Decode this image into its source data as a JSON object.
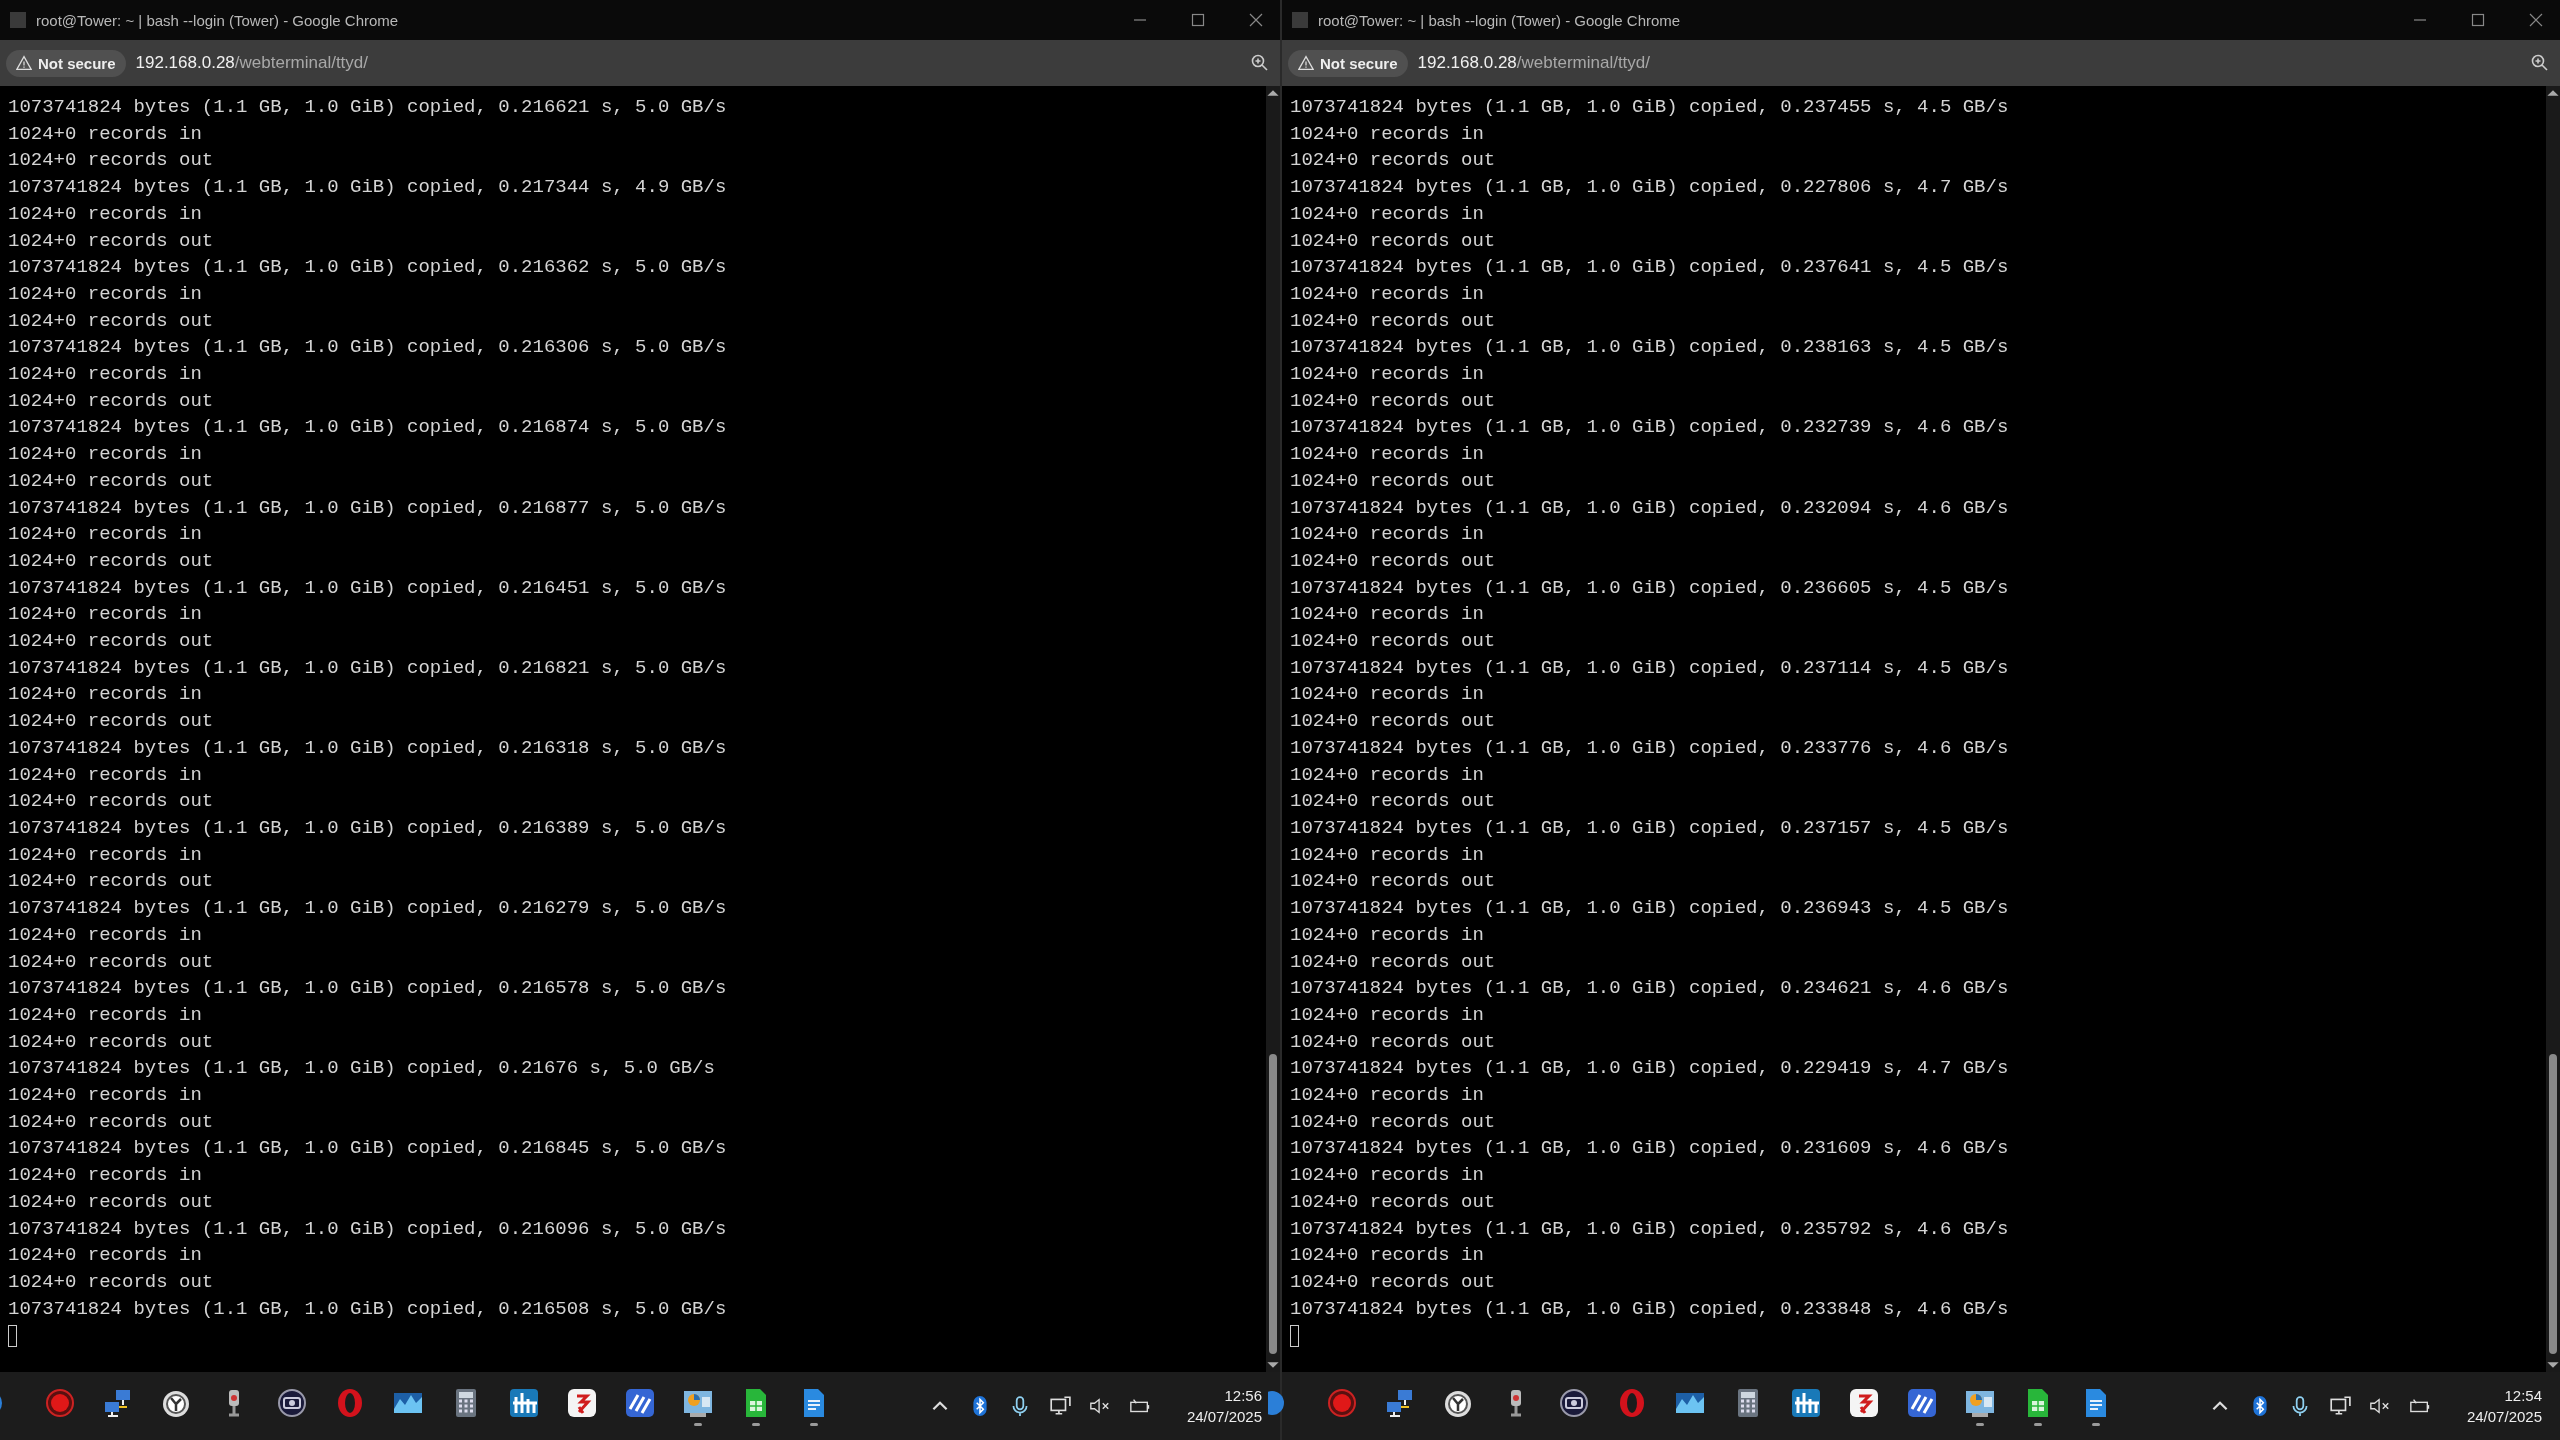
{
  "windows": [
    {
      "title": "root@Tower: ~ | bash --login (Tower) - Google Chrome",
      "security_label": "Not secure",
      "url_host": "192.168.0.28",
      "url_path": "/webterminal/ttyd/",
      "lines": [
        "1073741824 bytes (1.1 GB, 1.0 GiB) copied, 0.216621 s, 5.0 GB/s",
        "1024+0 records in",
        "1024+0 records out",
        "1073741824 bytes (1.1 GB, 1.0 GiB) copied, 0.217344 s, 4.9 GB/s",
        "1024+0 records in",
        "1024+0 records out",
        "1073741824 bytes (1.1 GB, 1.0 GiB) copied, 0.216362 s, 5.0 GB/s",
        "1024+0 records in",
        "1024+0 records out",
        "1073741824 bytes (1.1 GB, 1.0 GiB) copied, 0.216306 s, 5.0 GB/s",
        "1024+0 records in",
        "1024+0 records out",
        "1073741824 bytes (1.1 GB, 1.0 GiB) copied, 0.216874 s, 5.0 GB/s",
        "1024+0 records in",
        "1024+0 records out",
        "1073741824 bytes (1.1 GB, 1.0 GiB) copied, 0.216877 s, 5.0 GB/s",
        "1024+0 records in",
        "1024+0 records out",
        "1073741824 bytes (1.1 GB, 1.0 GiB) copied, 0.216451 s, 5.0 GB/s",
        "1024+0 records in",
        "1024+0 records out",
        "1073741824 bytes (1.1 GB, 1.0 GiB) copied, 0.216821 s, 5.0 GB/s",
        "1024+0 records in",
        "1024+0 records out",
        "1073741824 bytes (1.1 GB, 1.0 GiB) copied, 0.216318 s, 5.0 GB/s",
        "1024+0 records in",
        "1024+0 records out",
        "1073741824 bytes (1.1 GB, 1.0 GiB) copied, 0.216389 s, 5.0 GB/s",
        "1024+0 records in",
        "1024+0 records out",
        "1073741824 bytes (1.1 GB, 1.0 GiB) copied, 0.216279 s, 5.0 GB/s",
        "1024+0 records in",
        "1024+0 records out",
        "1073741824 bytes (1.1 GB, 1.0 GiB) copied, 0.216578 s, 5.0 GB/s",
        "1024+0 records in",
        "1024+0 records out",
        "1073741824 bytes (1.1 GB, 1.0 GiB) copied, 0.21676 s, 5.0 GB/s",
        "1024+0 records in",
        "1024+0 records out",
        "1073741824 bytes (1.1 GB, 1.0 GiB) copied, 0.216845 s, 5.0 GB/s",
        "1024+0 records in",
        "1024+0 records out",
        "1073741824 bytes (1.1 GB, 1.0 GiB) copied, 0.216096 s, 5.0 GB/s",
        "1024+0 records in",
        "1024+0 records out",
        "1073741824 bytes (1.1 GB, 1.0 GiB) copied, 0.216508 s, 5.0 GB/s"
      ],
      "taskbar": {
        "time": "12:56",
        "date": "24/07/2025"
      }
    },
    {
      "title": "root@Tower: ~ | bash --login (Tower) - Google Chrome",
      "security_label": "Not secure",
      "url_host": "192.168.0.28",
      "url_path": "/webterminal/ttyd/",
      "lines": [
        "1073741824 bytes (1.1 GB, 1.0 GiB) copied, 0.237455 s, 4.5 GB/s",
        "1024+0 records in",
        "1024+0 records out",
        "1073741824 bytes (1.1 GB, 1.0 GiB) copied, 0.227806 s, 4.7 GB/s",
        "1024+0 records in",
        "1024+0 records out",
        "1073741824 bytes (1.1 GB, 1.0 GiB) copied, 0.237641 s, 4.5 GB/s",
        "1024+0 records in",
        "1024+0 records out",
        "1073741824 bytes (1.1 GB, 1.0 GiB) copied, 0.238163 s, 4.5 GB/s",
        "1024+0 records in",
        "1024+0 records out",
        "1073741824 bytes (1.1 GB, 1.0 GiB) copied, 0.232739 s, 4.6 GB/s",
        "1024+0 records in",
        "1024+0 records out",
        "1073741824 bytes (1.1 GB, 1.0 GiB) copied, 0.232094 s, 4.6 GB/s",
        "1024+0 records in",
        "1024+0 records out",
        "1073741824 bytes (1.1 GB, 1.0 GiB) copied, 0.236605 s, 4.5 GB/s",
        "1024+0 records in",
        "1024+0 records out",
        "1073741824 bytes (1.1 GB, 1.0 GiB) copied, 0.237114 s, 4.5 GB/s",
        "1024+0 records in",
        "1024+0 records out",
        "1073741824 bytes (1.1 GB, 1.0 GiB) copied, 0.233776 s, 4.6 GB/s",
        "1024+0 records in",
        "1024+0 records out",
        "1073741824 bytes (1.1 GB, 1.0 GiB) copied, 0.237157 s, 4.5 GB/s",
        "1024+0 records in",
        "1024+0 records out",
        "1073741824 bytes (1.1 GB, 1.0 GiB) copied, 0.236943 s, 4.5 GB/s",
        "1024+0 records in",
        "1024+0 records out",
        "1073741824 bytes (1.1 GB, 1.0 GiB) copied, 0.234621 s, 4.6 GB/s",
        "1024+0 records in",
        "1024+0 records out",
        "1073741824 bytes (1.1 GB, 1.0 GiB) copied, 0.229419 s, 4.7 GB/s",
        "1024+0 records in",
        "1024+0 records out",
        "1073741824 bytes (1.1 GB, 1.0 GiB) copied, 0.231609 s, 4.6 GB/s",
        "1024+0 records in",
        "1024+0 records out",
        "1073741824 bytes (1.1 GB, 1.0 GiB) copied, 0.235792 s, 4.6 GB/s",
        "1024+0 records in",
        "1024+0 records out",
        "1073741824 bytes (1.1 GB, 1.0 GiB) copied, 0.233848 s, 4.6 GB/s"
      ],
      "taskbar": {
        "time": "12:54",
        "date": "24/07/2025"
      }
    }
  ],
  "taskbar_apps": [
    {
      "kind": "edge",
      "running": false
    },
    {
      "kind": "record",
      "running": false
    },
    {
      "kind": "network",
      "running": false
    },
    {
      "kind": "clock",
      "running": false
    },
    {
      "kind": "mic",
      "running": false
    },
    {
      "kind": "camera",
      "running": false
    },
    {
      "kind": "ring",
      "running": false
    },
    {
      "kind": "waves",
      "running": false
    },
    {
      "kind": "calculator",
      "running": false
    },
    {
      "kind": "bars",
      "running": false
    },
    {
      "kind": "swirl",
      "running": false
    },
    {
      "kind": "stripes",
      "running": false
    },
    {
      "kind": "chart",
      "running": true
    },
    {
      "kind": "sheet",
      "running": true
    },
    {
      "kind": "doc",
      "running": true
    }
  ]
}
